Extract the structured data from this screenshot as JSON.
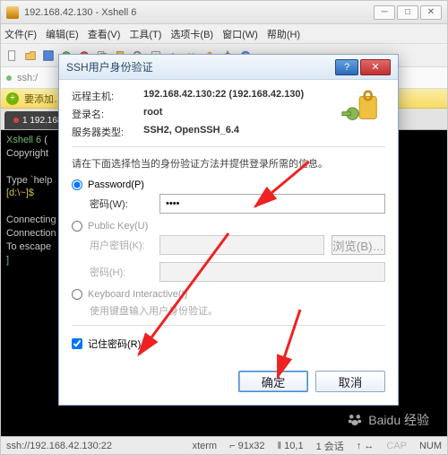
{
  "window": {
    "title": "192.168.42.130 - Xshell 6"
  },
  "menubar": [
    "文件(F)",
    "编辑(E)",
    "查看(V)",
    "工具(T)",
    "选项卡(B)",
    "窗口(W)",
    "帮助(H)"
  ],
  "pathbar": {
    "prefix": "ssh:/",
    "ellipsis": "…"
  },
  "promptbar": {
    "text": "要添加…"
  },
  "tab": {
    "label": "1 192.168…"
  },
  "terminal": {
    "l1a": "Xshell 6",
    "l1b": " (",
    "l2": "Copyright",
    "l3a": "Type `help",
    "l3b": "[d:\\~]$",
    "l4": "Connecting",
    "l5": "Connection",
    "l6a": "To escape ",
    "l6b": "]"
  },
  "dialog": {
    "title": "SSH用户身份验证",
    "host_label": "远程主机:",
    "host_value": "192.168.42.130:22 (192.168.42.130)",
    "login_label": "登录名:",
    "login_value": "root",
    "server_label": "服务器类型:",
    "server_value": "SSH2, OpenSSH_6.4",
    "instruction": "请在下面选择恰当的身份验证方法并提供登录所需的信息。",
    "opt_password": "Password(P)",
    "pwd_label": "密码(W):",
    "pwd_value": "••••",
    "opt_pubkey": "Public Key(U)",
    "userkey_label": "用户密钥(K):",
    "browse": "浏览(B)…",
    "passphrase_label": "密码(H):",
    "opt_kbd": "Keyboard Interactive(I)",
    "kbd_sub": "使用键盘输入用户身份验证。",
    "remember": "记住密码(R)",
    "ok": "确定",
    "cancel": "取消"
  },
  "statusbar": {
    "host": "ssh://192.168.42.130:22",
    "term": "xterm",
    "size": "⌐ 91x32",
    "pos": "‖ 10,1",
    "sess": "1 会话",
    "caps": "CAP",
    "num": "NUM"
  },
  "watermark": "Baidu 经验"
}
